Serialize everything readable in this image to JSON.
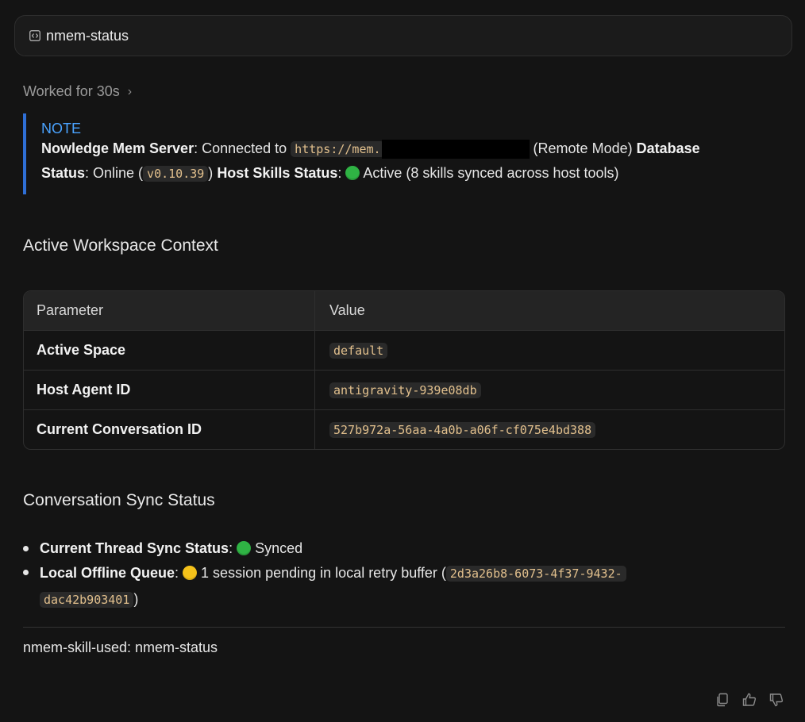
{
  "header": {
    "title": "nmem-status",
    "icon": "code-file-icon"
  },
  "worked": {
    "label": "Worked for 30s",
    "chevron": "›"
  },
  "note": {
    "title": "NOTE",
    "server_label": "Nowledge Mem Server",
    "server_text": ": Connected to ",
    "server_url": "https://mem.",
    "remote_mode": " (Remote Mode) ",
    "db_label_1": "Database",
    "db_label_2": "Status",
    "db_text": ": Online (",
    "db_version": "v0.10.39",
    "close_paren": ")",
    "host_label": "Host Skills Status",
    "host_sep": ": ",
    "host_text": " Active (8 skills synced across host tools)"
  },
  "workspace": {
    "heading": "Active Workspace Context",
    "columns": [
      "Parameter",
      "Value"
    ],
    "rows": [
      {
        "param": "Active Space",
        "value": "default"
      },
      {
        "param": "Host Agent ID",
        "value": "antigravity-939e08db"
      },
      {
        "param": "Current Conversation ID",
        "value": "527b972a-56aa-4a0b-a06f-cf075e4bd388"
      }
    ]
  },
  "sync": {
    "heading": "Conversation Sync Status",
    "thread_label": "Current Thread Sync Status",
    "thread_sep": ": ",
    "thread_value": " Synced",
    "queue_label": "Local Offline Queue",
    "queue_sep": ": ",
    "queue_text": " 1 session pending in local retry buffer (",
    "queue_id_1": "2d3a26b8-6073-4f37-9432-",
    "queue_id_2": "dac42b903401",
    "queue_close": ")"
  },
  "footer": {
    "text": "nmem-skill-used: nmem-status"
  },
  "colors": {
    "accent": "#2f6fd6",
    "note_title": "#4aa3ff",
    "code": "#e2c08d",
    "green": "#2fb344",
    "yellow": "#f5c21a"
  }
}
